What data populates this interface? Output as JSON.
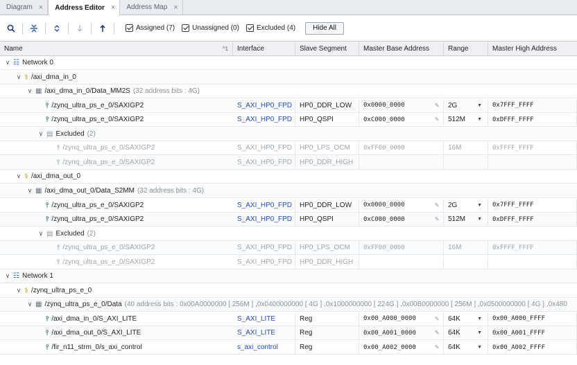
{
  "tabs": [
    {
      "label": "Diagram",
      "active": false
    },
    {
      "label": "Address Editor",
      "active": true
    },
    {
      "label": "Address Map",
      "active": false
    }
  ],
  "toolbar": {
    "filters": [
      {
        "label": "Assigned (7)"
      },
      {
        "label": "Unassigned (0)"
      },
      {
        "label": "Excluded (4)"
      }
    ],
    "hide_all": "Hide All"
  },
  "columns": {
    "name": "Name",
    "sort_indicator": "^1",
    "interface": "Interface",
    "slave_segment": "Slave Segment",
    "master_base": "Master Base Address",
    "range": "Range",
    "master_high": "Master High Address"
  },
  "rows": [
    {
      "kind": "network",
      "label": "Network 0"
    },
    {
      "kind": "ip",
      "label": "/axi_dma_in_0"
    },
    {
      "kind": "space",
      "label": "/axi_dma_in_0/Data_MM2S",
      "extra": "(32 address bits : 4G)"
    },
    {
      "kind": "seg",
      "label": "/zynq_ultra_ps_e_0/SAXIGP2",
      "iface": "S_AXI_HP0_FPD",
      "slave": "HP0_DDR_LOW",
      "base": "0x0000_0000",
      "range": "2G",
      "high": "0x7FFF_FFFF"
    },
    {
      "kind": "seg",
      "label": "/zynq_ultra_ps_e_0/SAXIGP2",
      "iface": "S_AXI_HP0_FPD",
      "slave": "HP0_QSPI",
      "base": "0xC000_0000",
      "range": "512M",
      "high": "0xDFFF_FFFF"
    },
    {
      "kind": "excl",
      "label": "Excluded",
      "extra": "(2)"
    },
    {
      "kind": "segdim",
      "label": "/zynq_ultra_ps_e_0/SAXIGP2",
      "iface": "S_AXI_HP0_FPD",
      "slave": "HP0_LPS_OCM",
      "base": "0xFF00_0000",
      "range": "16M",
      "high": "0xFFFF_FFFF"
    },
    {
      "kind": "segdim",
      "label": "/zynq_ultra_ps_e_0/SAXIGP2",
      "iface": "S_AXI_HP0_FPD",
      "slave": "HP0_DDR_HIGH",
      "base": "",
      "range": "",
      "high": ""
    },
    {
      "kind": "ip",
      "label": "/axi_dma_out_0"
    },
    {
      "kind": "space",
      "label": "/axi_dma_out_0/Data_S2MM",
      "extra": "(32 address bits : 4G)"
    },
    {
      "kind": "seg",
      "label": "/zynq_ultra_ps_e_0/SAXIGP2",
      "iface": "S_AXI_HP0_FPD",
      "slave": "HP0_DDR_LOW",
      "base": "0x0000_0000",
      "range": "2G",
      "high": "0x7FFF_FFFF"
    },
    {
      "kind": "seg",
      "label": "/zynq_ultra_ps_e_0/SAXIGP2",
      "iface": "S_AXI_HP0_FPD",
      "slave": "HP0_QSPI",
      "base": "0xC000_0000",
      "range": "512M",
      "high": "0xDFFF_FFFF"
    },
    {
      "kind": "excl",
      "label": "Excluded",
      "extra": "(2)"
    },
    {
      "kind": "segdim",
      "label": "/zynq_ultra_ps_e_0/SAXIGP2",
      "iface": "S_AXI_HP0_FPD",
      "slave": "HP0_LPS_OCM",
      "base": "0xFF00_0000",
      "range": "16M",
      "high": "0xFFFF_FFFF"
    },
    {
      "kind": "segdim",
      "label": "/zynq_ultra_ps_e_0/SAXIGP2",
      "iface": "S_AXI_HP0_FPD",
      "slave": "HP0_DDR_HIGH",
      "base": "",
      "range": "",
      "high": ""
    },
    {
      "kind": "network",
      "label": "Network 1"
    },
    {
      "kind": "ip",
      "label": "/zynq_ultra_ps_e_0"
    },
    {
      "kind": "space",
      "label": "/zynq_ultra_ps_e_0/Data",
      "extra": "(40 address bits : 0x00A0000000 [ 256M ] ,0x0400000000 [ 4G ] ,0x1000000000 [ 224G ] ,0x00B0000000 [ 256M ] ,0x0500000000 [ 4G ] ,0x480"
    },
    {
      "kind": "seg",
      "label": "/axi_dma_in_0/S_AXI_LITE",
      "iface": "S_AXI_LITE",
      "slave": "Reg",
      "base": "0x00_A000_0000",
      "range": "64K",
      "high": "0x00_A000_FFFF"
    },
    {
      "kind": "seg",
      "label": "/axi_dma_out_0/S_AXI_LITE",
      "iface": "S_AXI_LITE",
      "slave": "Reg",
      "base": "0x00_A001_0000",
      "range": "64K",
      "high": "0x00_A001_FFFF"
    },
    {
      "kind": "seg",
      "label": "/fir_n11_strm_0/s_axi_control",
      "iface": "s_axi_control",
      "slave": "Reg",
      "base": "0x00_A002_0000",
      "range": "64K",
      "high": "0x00_A002_FFFF"
    }
  ]
}
